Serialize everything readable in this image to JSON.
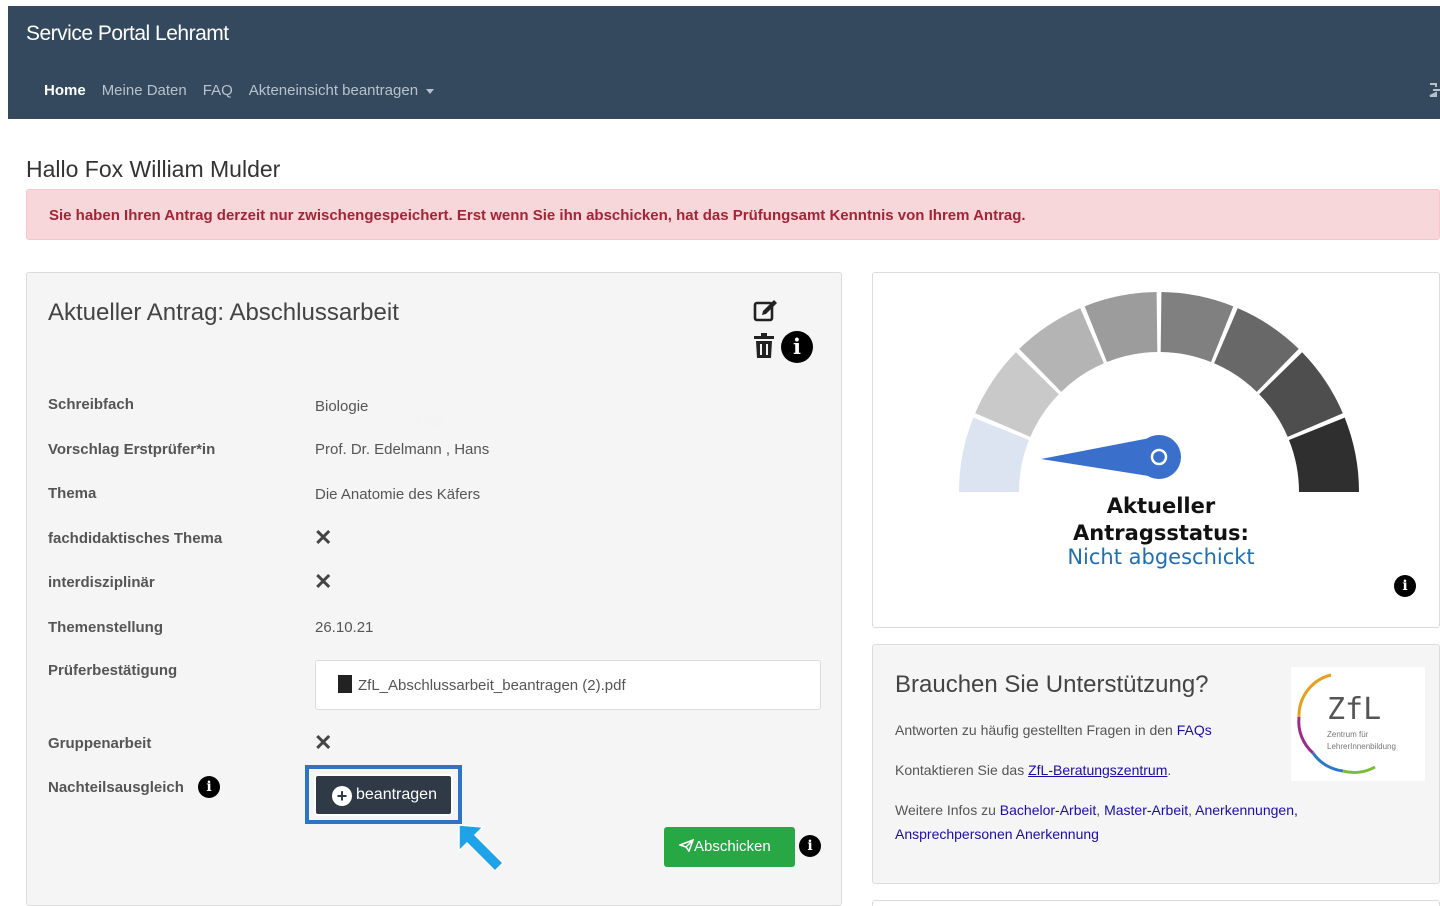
{
  "navbar": {
    "brand": "Service Portal Lehramt",
    "items": [
      {
        "label": "Home",
        "active": true
      },
      {
        "label": "Meine Daten",
        "active": false
      },
      {
        "label": "FAQ",
        "active": false
      },
      {
        "label": "Akteneinsicht beantragen",
        "active": false,
        "dropdown": true
      }
    ],
    "logout_icon": "logout-icon"
  },
  "greeting": "Hallo Fox William Mulder",
  "alert": {
    "text": "Sie haben Ihren Antrag derzeit nur zwischengespeichert. Erst wenn Sie ihn abschicken, hat das Prüfungsamt Kenntnis von Ihrem Antrag.",
    "color": "#f8d7da"
  },
  "application": {
    "title": "Aktueller Antrag: Abschlussarbeit",
    "faq_ghost": "FAQ",
    "fields": [
      {
        "label": "Schreibfach",
        "value": "Biologie"
      },
      {
        "label": "Vorschlag Erstprüfer*in",
        "value": "Prof. Dr. Edelmann , Hans"
      },
      {
        "label": "Thema",
        "value": "Die Anatomie des Käfers"
      },
      {
        "label": "fachdidaktisches Thema",
        "value": "✕"
      },
      {
        "label": "interdisziplinär",
        "value": "✕"
      },
      {
        "label": "Themenstellung",
        "value": "26.10.21"
      },
      {
        "label": "Prüferbestätigung",
        "value": "ZfL_Abschlussarbeit_beantragen (2).pdf"
      },
      {
        "label": "Gruppenarbeit",
        "value": "✕"
      },
      {
        "label": "Nachteilsausgleich",
        "value": ""
      }
    ],
    "beantragen_label": "beantragen",
    "submit_label": "Abschicken",
    "info_glyph": "i"
  },
  "status": {
    "title_line1": "Aktueller",
    "title_line2": "Antragsstatus:",
    "value": "Nicht abgeschickt",
    "level": 0,
    "segment_colors": [
      "#dce4f2",
      "#c9c9c9",
      "#b4b4b4",
      "#9c9c9c",
      "#808080",
      "#686868",
      "#4e4e4e",
      "#2f2f2f"
    ],
    "needle_color": "#3a6fcc"
  },
  "help": {
    "title": "Brauchen Sie Unterstützung?",
    "faq_text": "Antworten zu häufig gestellten Fragen in den",
    "faq_link": "FAQs",
    "contact_text": "Kontaktieren Sie das",
    "contact_link": "ZfL-Beratungszentrum",
    "contact_end": ".",
    "more_text": "Weitere Infos zu",
    "links": [
      "Bachelor-Arbeit",
      "Master-Arbeit",
      "Anerkennungen,",
      "Ansprechpersonen Anerkennung"
    ],
    "logo_text": "ZfL",
    "logo_sub1": "Zentrum für",
    "logo_sub2": "LehrerInnenbildung"
  }
}
